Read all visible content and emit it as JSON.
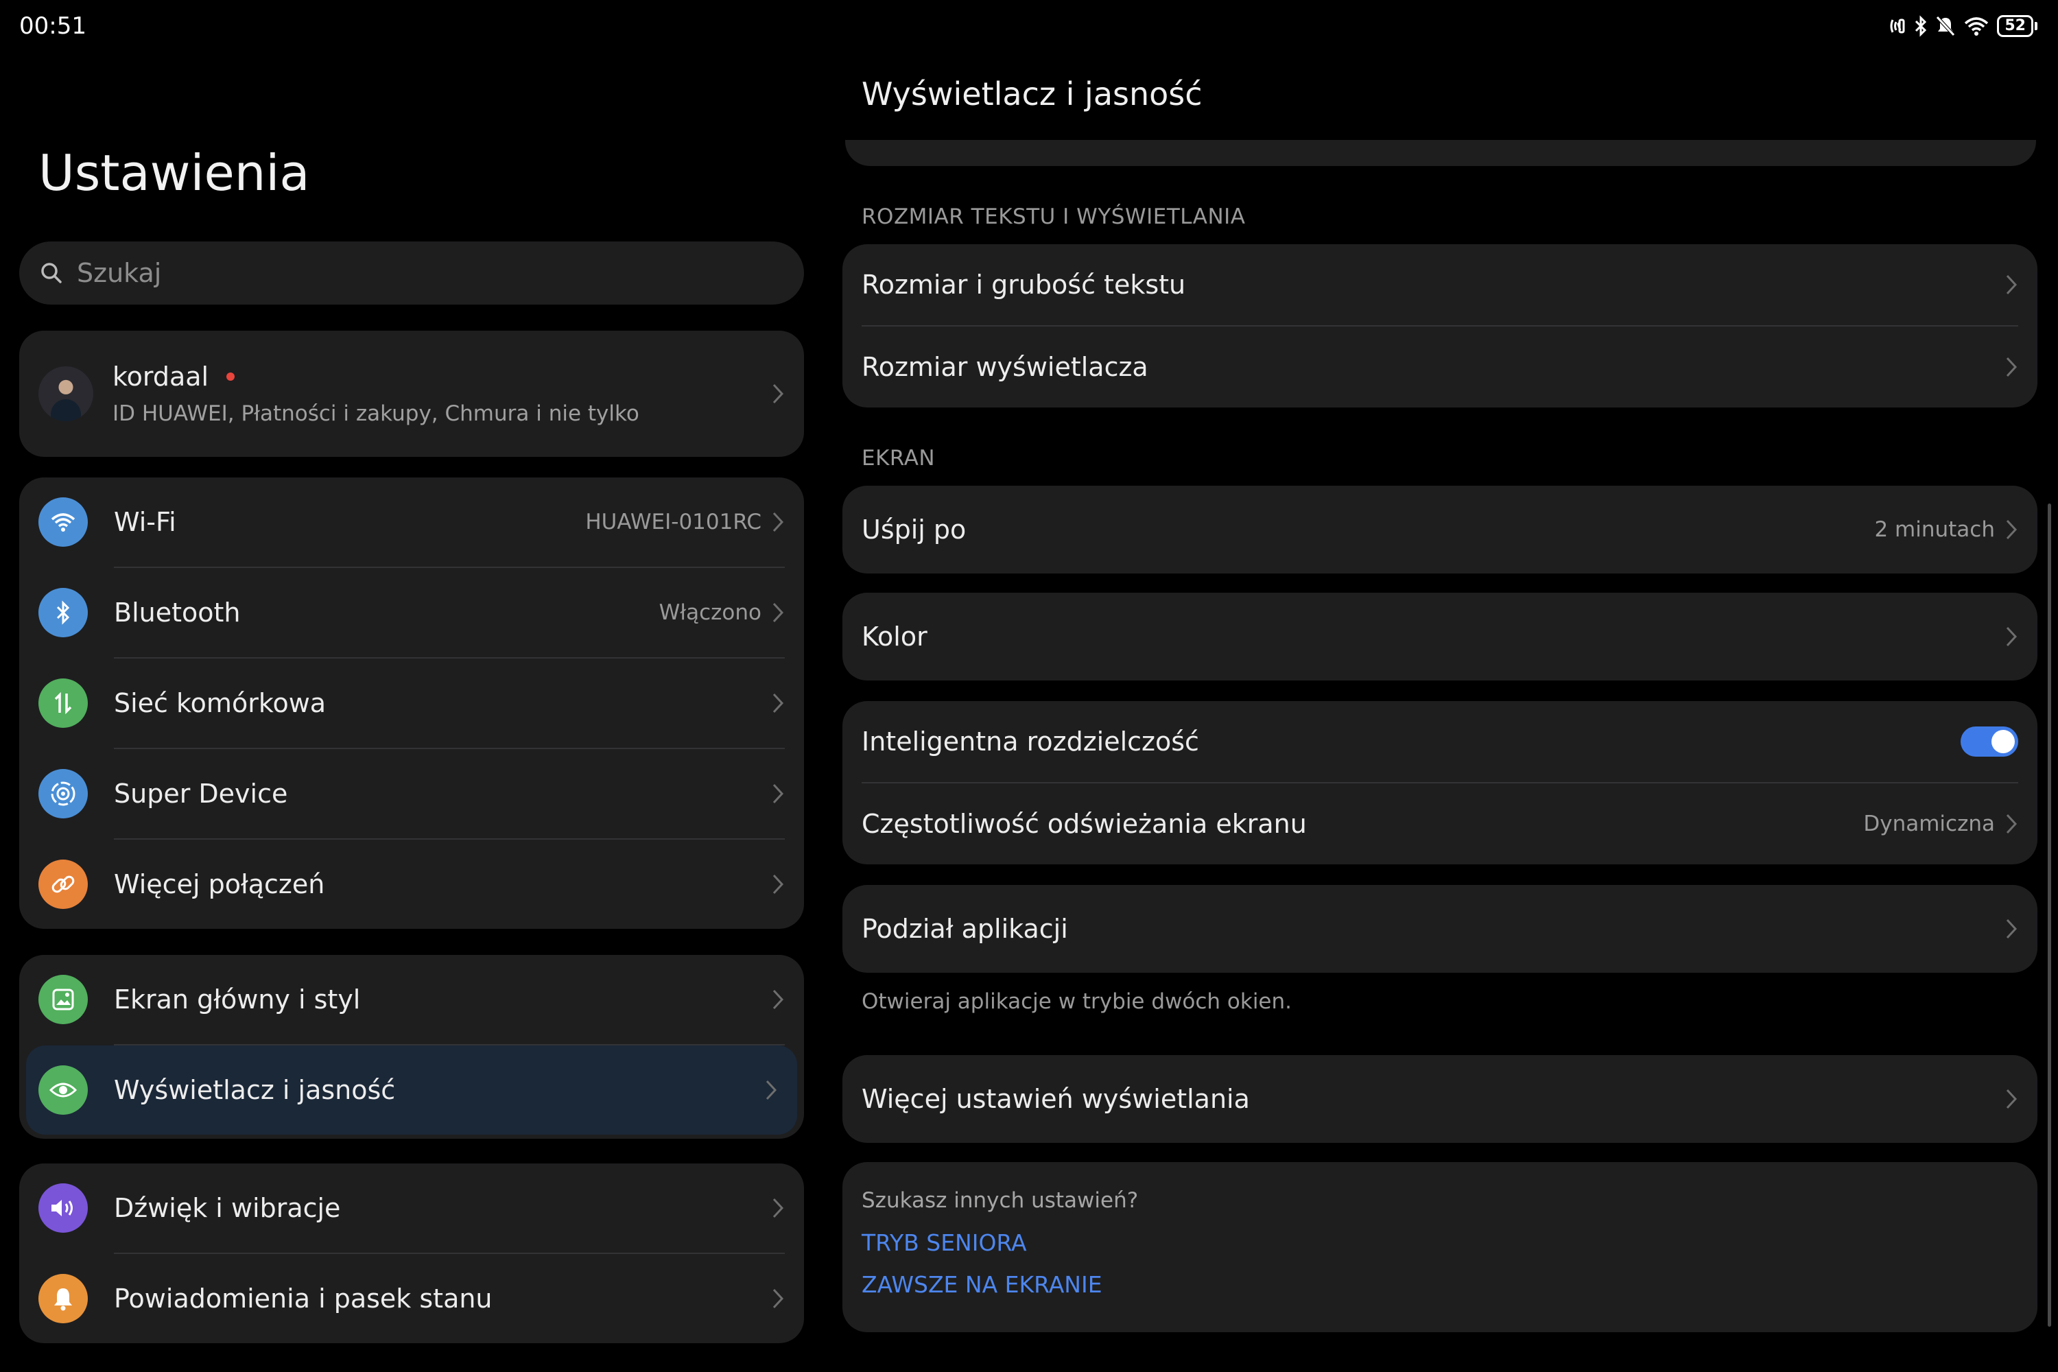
{
  "status_bar": {
    "time": "00:51",
    "battery": "52"
  },
  "left": {
    "title": "Ustawienia",
    "search_placeholder": "Szukaj",
    "profile": {
      "name": "kordaal",
      "subtitle": "ID HUAWEI, Płatności i zakupy, Chmura i nie tylko"
    },
    "group1": [
      {
        "label": "Wi-Fi",
        "value": "HUAWEI-0101RC",
        "icon": "wifi-icon",
        "color": "#4a8fd6"
      },
      {
        "label": "Bluetooth",
        "value": "Włączono",
        "icon": "bluetooth-icon",
        "color": "#4a8fd6"
      },
      {
        "label": "Sieć komórkowa",
        "value": "",
        "icon": "cellular-icon",
        "color": "#52b05e"
      },
      {
        "label": "Super Device",
        "value": "",
        "icon": "super-device-icon",
        "color": "#4a8fd6"
      },
      {
        "label": "Więcej połączeń",
        "value": "",
        "icon": "link-icon",
        "color": "#e8833a"
      }
    ],
    "group2": [
      {
        "label": "Ekran główny i styl",
        "icon": "image-icon",
        "color": "#52b05e"
      },
      {
        "label": "Wyświetlacz i jasność",
        "icon": "eye-icon",
        "color": "#52b05e"
      }
    ],
    "group3": [
      {
        "label": "Dźwięk i wibracje",
        "icon": "speaker-icon",
        "color": "#7a55d8"
      },
      {
        "label": "Powiadomienia i pasek stanu",
        "icon": "bell-icon",
        "color": "#e8933a"
      }
    ]
  },
  "right": {
    "title": "Wyświetlacz i jasność",
    "section_text_size": "ROZMIAR TEKSTU I WYŚWIETLANIA",
    "text_size_label": "Rozmiar i grubość tekstu",
    "display_size_label": "Rozmiar wyświetlacza",
    "section_screen": "EKRAN",
    "sleep_label": "Uśpij po",
    "sleep_value": "2 minutach",
    "color_label": "Kolor",
    "smart_resolution_label": "Inteligentna rozdzielczość",
    "smart_resolution_on": true,
    "refresh_label": "Częstotliwość odświeżania ekranu",
    "refresh_value": "Dynamiczna",
    "app_split_label": "Podział aplikacji",
    "app_split_hint": "Otwieraj aplikacje w trybie dwóch okien.",
    "more_display_label": "Więcej ustawień wyświetlania",
    "other_question": "Szukasz innych ustawień?",
    "link_senior": "TRYB SENIORA",
    "link_aod": "ZAWSZE NA EKRANIE",
    "accent_color": "#3f7be8"
  }
}
